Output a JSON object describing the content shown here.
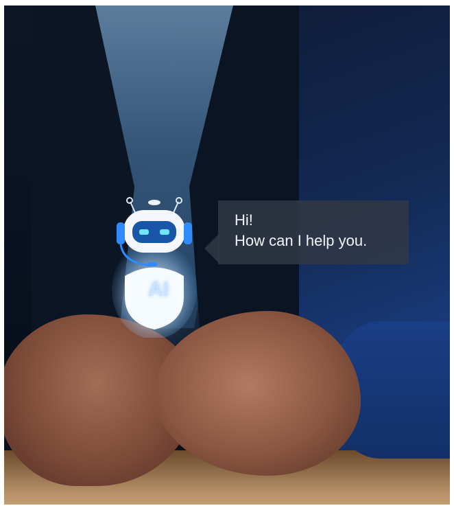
{
  "chat_bubble": {
    "line1": "Hi!",
    "line2": "How can I help you."
  },
  "robot": {
    "label": "AI",
    "accent_color": "#2f8cff",
    "glow_color": "#d9ecff"
  },
  "scene": {
    "icons": [
      "robot-head-icon",
      "headset-icon",
      "ai-shield-icon"
    ]
  }
}
